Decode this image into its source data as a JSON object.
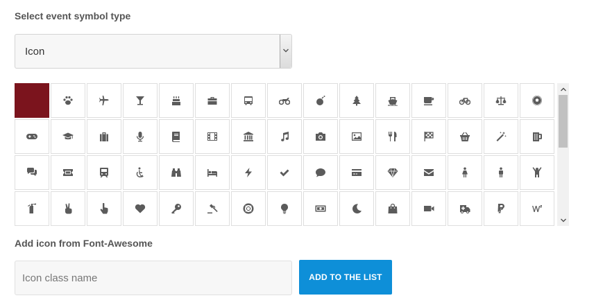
{
  "labels": {
    "select_type": "Select event symbol type",
    "add_icon": "Add icon from Font-Awesome"
  },
  "select": {
    "value": "Icon"
  },
  "input": {
    "placeholder": "Icon class name"
  },
  "button": {
    "label": "ADD TO THE LIST"
  },
  "colors": {
    "selected": "#7b141d",
    "button": "#0e8fd8",
    "icon": "#5b5b5b"
  },
  "icons": [
    "color-swatch",
    "paw-icon",
    "plane-icon",
    "cocktail-icon",
    "birthday-cake-icon",
    "briefcase-icon",
    "bus-icon",
    "motorcycle-icon",
    "bomb-icon",
    "tree-icon",
    "ship-icon",
    "coffee-icon",
    "bicycle-icon",
    "balance-scale-icon",
    "soccer-ball-icon",
    "gamepad-icon",
    "graduation-cap-icon",
    "suitcase-icon",
    "microphone-icon",
    "book-icon",
    "film-icon",
    "bank-icon",
    "music-icon",
    "camera-icon",
    "image-icon",
    "cutlery-icon",
    "flag-checkered-icon",
    "shopping-basket-icon",
    "magic-wand-icon",
    "beer-icon",
    "comments-icon",
    "ticket-icon",
    "train-icon",
    "wheelchair-icon",
    "binoculars-icon",
    "bed-icon",
    "bolt-icon",
    "check-icon",
    "comment-icon",
    "credit-card-icon",
    "diamond-icon",
    "envelope-icon",
    "female-icon",
    "male-icon",
    "child-icon",
    "fire-extinguisher-icon",
    "hand-peace-icon",
    "hand-pointer-icon",
    "heart-icon",
    "key-icon",
    "gavel-icon",
    "life-ring-icon",
    "lightbulb-icon",
    "money-icon",
    "moon-icon",
    "shopping-bag-icon",
    "video-camera-icon",
    "ambulance-icon",
    "paypal-icon",
    "wine-icon"
  ]
}
